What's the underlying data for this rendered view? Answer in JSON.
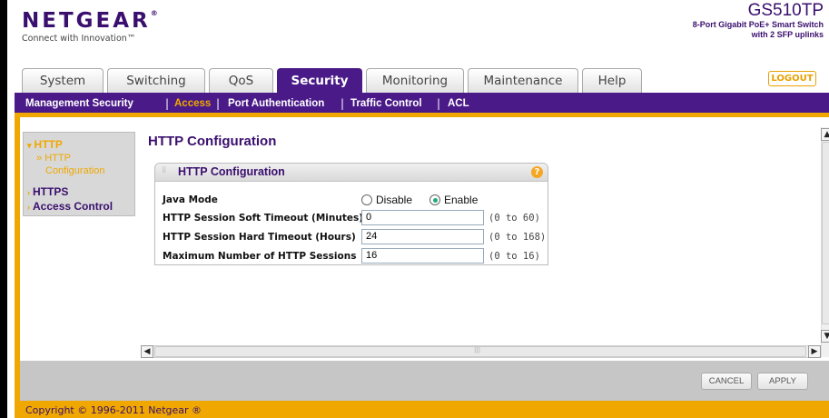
{
  "header": {
    "logo": "NETGEAR",
    "logo_mark": "®",
    "tagline": "Connect with Innovation™",
    "model_name": "GS510TP",
    "model_desc_line1": "8-Port Gigabit PoE+ Smart Switch",
    "model_desc_line2": "with 2 SFP uplinks",
    "logout_label": "LOGOUT"
  },
  "tabs": [
    {
      "label": "System",
      "active": false
    },
    {
      "label": "Switching",
      "active": false
    },
    {
      "label": "QoS",
      "active": false
    },
    {
      "label": "Security",
      "active": true
    },
    {
      "label": "Monitoring",
      "active": false
    },
    {
      "label": "Maintenance",
      "active": false
    },
    {
      "label": "Help",
      "active": false
    }
  ],
  "subnav": [
    {
      "label": "Management Security",
      "active": false
    },
    {
      "label": "Access",
      "active": true
    },
    {
      "label": "Port Authentication",
      "active": false
    },
    {
      "label": "Traffic Control",
      "active": false
    },
    {
      "label": "ACL",
      "active": false
    }
  ],
  "sidebar": {
    "items": [
      {
        "label": "HTTP",
        "expanded": true
      },
      {
        "label": "HTTPS",
        "expanded": false
      },
      {
        "label": "Access Control",
        "expanded": false
      }
    ],
    "sub_item_line1": "HTTP",
    "sub_item_line2": "Configuration"
  },
  "main": {
    "page_title": "HTTP Configuration",
    "panel_title": "HTTP Configuration",
    "help_glyph": "?",
    "java_mode": {
      "label": "Java Mode",
      "options": [
        "Disable",
        "Enable"
      ],
      "selected": "Enable"
    },
    "fields": [
      {
        "label": "HTTP Session Soft Timeout (Minutes)",
        "value": "0",
        "range": "(0 to 60)"
      },
      {
        "label": "HTTP Session Hard Timeout (Hours)",
        "value": "24",
        "range": "(0 to 168)"
      },
      {
        "label": "Maximum Number of HTTP Sessions",
        "value": "16",
        "range": "(0 to 16)"
      }
    ]
  },
  "actions": {
    "cancel": "CANCEL",
    "apply": "APPLY"
  },
  "footer": {
    "copyright": "Copyright © 1996-2011 Netgear ®"
  },
  "colors": {
    "brand_purple": "#4a1a88",
    "accent_orange": "#f0a800",
    "title_purple": "#3a0f6e"
  }
}
